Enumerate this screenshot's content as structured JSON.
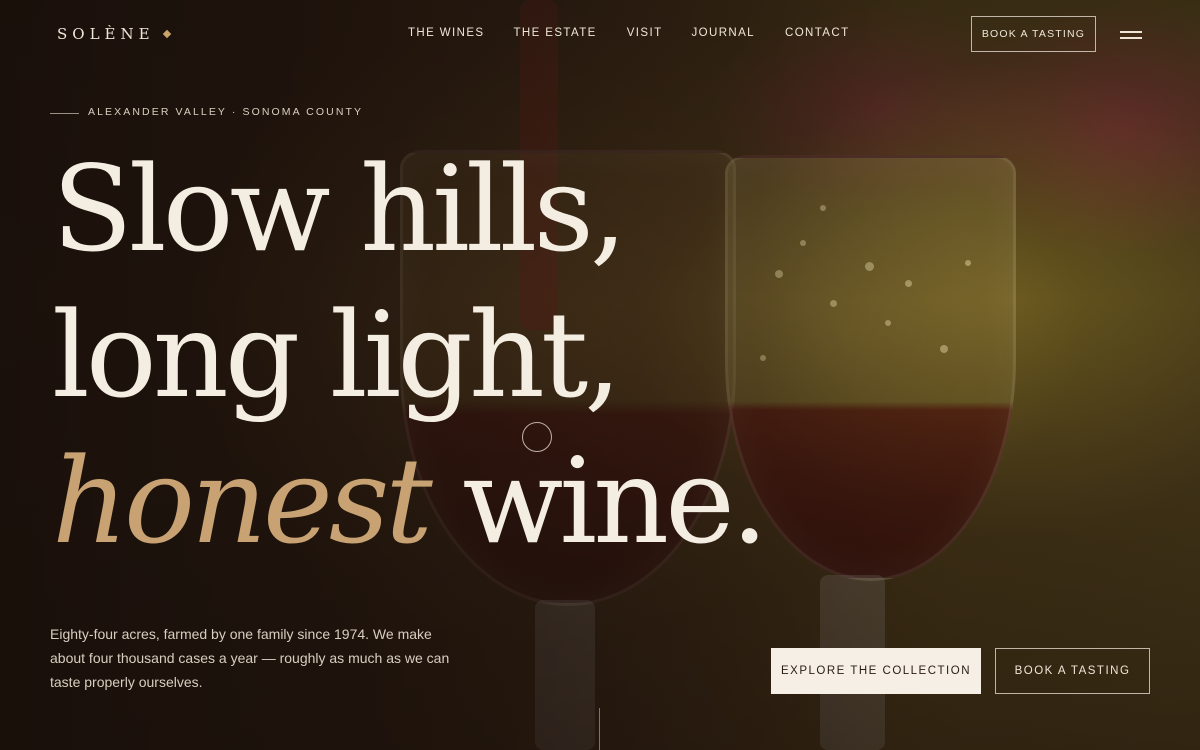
{
  "brand": {
    "name": "SOLÈNE"
  },
  "nav": {
    "items": [
      "THE WINES",
      "THE ESTATE",
      "VISIT",
      "JOURNAL",
      "CONTACT"
    ],
    "cta_label": "BOOK A TASTING",
    "menu_icon": "hamburger-menu-icon"
  },
  "hero": {
    "eyebrow": "ALEXANDER VALLEY · SONOMA COUNTY",
    "headline": {
      "line1": "Slow hills,",
      "line2": "long light,",
      "line3_italic": "honest",
      "line3_rest": " wine."
    },
    "intro": "Eighty-four acres, farmed by one family since 1974. We make about four thousand cases a year — roughly as much as we can taste properly ourselves.",
    "primary_cta": "EXPLORE THE COLLECTION",
    "secondary_cta": "BOOK A TASTING"
  },
  "colors": {
    "accent_gold": "#c8a272",
    "background": "#1e130d",
    "text": "#f4ede2"
  }
}
